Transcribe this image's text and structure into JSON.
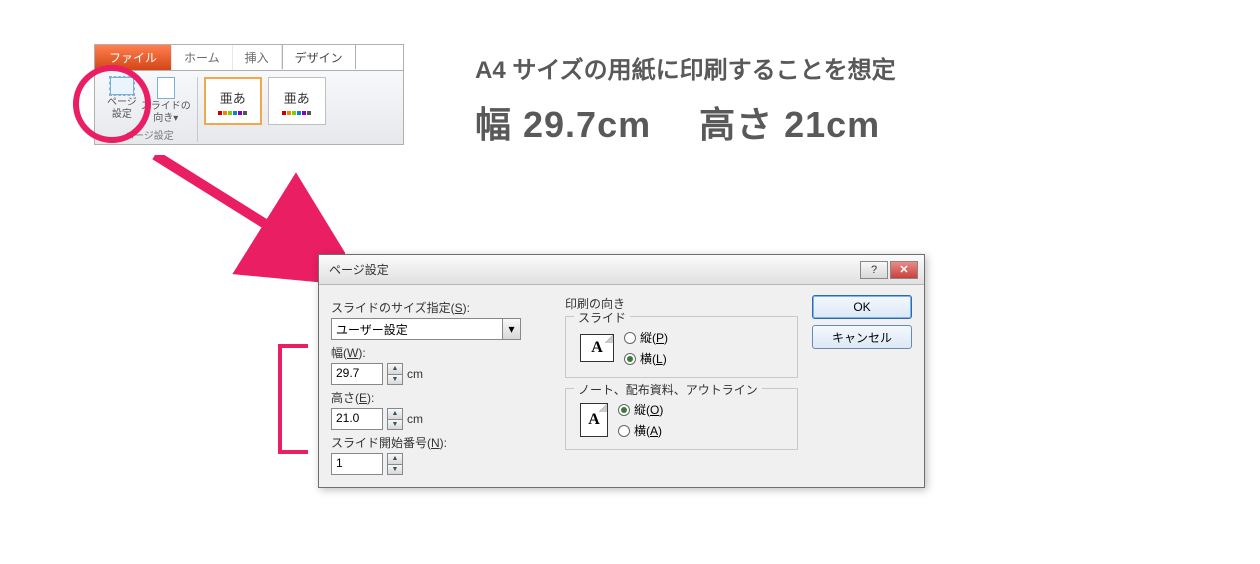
{
  "ribbon": {
    "tabs": {
      "file": "ファイル",
      "home": "ホーム",
      "insert": "挿入",
      "design": "デザイン"
    },
    "page_setup": {
      "label_line1": "ページ",
      "label_line2": "設定"
    },
    "orientation": {
      "label_line1": "スライドの",
      "label_line2": "向き▾"
    },
    "group_label": "ページ設定",
    "theme_sample": "亜あ"
  },
  "annotation": {
    "line1": "A4 サイズの用紙に印刷することを想定",
    "line2a": "幅 29.7cm",
    "line2b": "高さ 21cm"
  },
  "dialog": {
    "title": "ページ設定",
    "size_label": "スライドのサイズ指定(S):",
    "size_value": "ユーザー設定",
    "width_label": "幅(W):",
    "width_value": "29.7",
    "height_label": "高さ(E):",
    "height_value": "21.0",
    "unit": "cm",
    "startnum_label": "スライド開始番号(N):",
    "startnum_value": "1",
    "orientation_group": "印刷の向き",
    "slides_label": "スライド",
    "portrait_label": "縦(P)",
    "landscape_label": "横(L)",
    "notes_label": "ノート、配布資料、アウトライン",
    "portrait2_label": "縦(O)",
    "landscape2_label": "横(A)",
    "ok": "OK",
    "cancel": "キャンセル",
    "help": "?",
    "close": "✕",
    "preview_letter": "A"
  }
}
